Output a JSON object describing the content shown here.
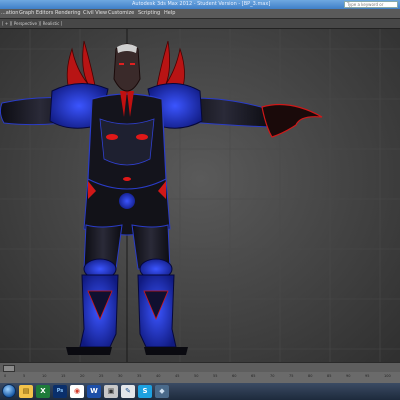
{
  "window": {
    "title": "Autodesk 3ds Max 2012 - Student Version - [BP_3.max]",
    "help_search_placeholder": "Type a keyword or phrase"
  },
  "menu": {
    "items": [
      "...ation",
      "Graph Editors",
      "Rendering",
      "Civil View",
      "Customize",
      "Scripting",
      "Help"
    ]
  },
  "toolbar": {
    "viewport_label": "[ + ][ Perspective ][ Realistic ]"
  },
  "timeline": {
    "ticks": [
      "0",
      "5",
      "10",
      "15",
      "20",
      "25",
      "30",
      "35",
      "40",
      "45",
      "50",
      "55",
      "60",
      "65",
      "70",
      "75",
      "80",
      "85",
      "90",
      "95",
      "100"
    ]
  },
  "taskbar": {
    "apps": [
      {
        "name": "explorer",
        "color": "#f2c24a",
        "glyph": "▤"
      },
      {
        "name": "excel",
        "color": "#1e7b3a",
        "glyph": "X"
      },
      {
        "name": "photoshop",
        "color": "#0a2f6b",
        "glyph": "Ps"
      },
      {
        "name": "chrome",
        "color": "#ffffff",
        "glyph": "◉"
      },
      {
        "name": "word",
        "color": "#1d4fa8",
        "glyph": "W"
      },
      {
        "name": "app",
        "color": "#c8c8c8",
        "glyph": "▣"
      },
      {
        "name": "paint",
        "color": "#e3e6ea",
        "glyph": "✎"
      },
      {
        "name": "skype",
        "color": "#1da1e0",
        "glyph": "S"
      },
      {
        "name": "3dsmax",
        "color": "#4a6a8a",
        "glyph": "◆"
      }
    ],
    "clock": ""
  },
  "colors": {
    "armor_blue": "#2a40ff",
    "armor_dark": "#16161c",
    "accent_red": "#e01818"
  }
}
